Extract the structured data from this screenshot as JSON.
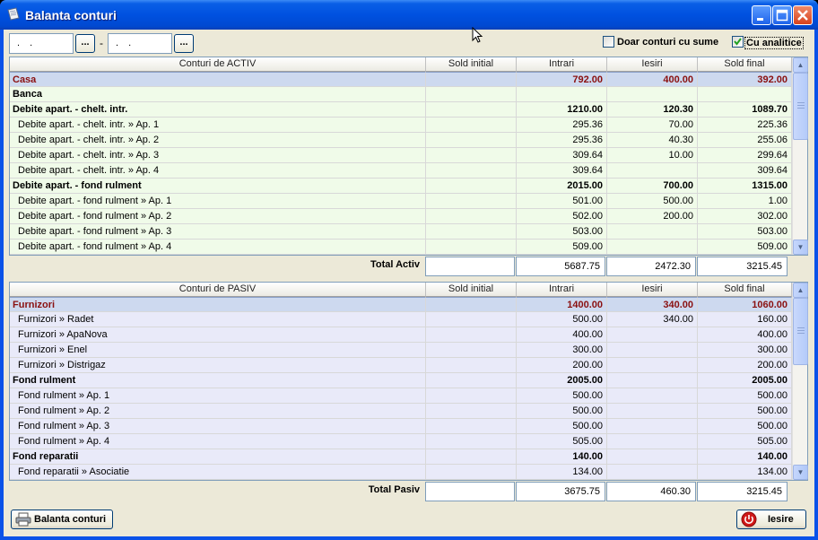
{
  "window": {
    "title": "Balanta conturi"
  },
  "filter": {
    "date_from": " .  . ",
    "date_to": " .  . ",
    "pick_label": "...",
    "separator": "-",
    "only_sums_label": "Doar conturi cu sume",
    "only_sums_checked": false,
    "analytic_label": "Cu analitice",
    "analytic_checked": true
  },
  "columns": [
    "Sold initial",
    "Intrari",
    "Iesiri",
    "Sold final"
  ],
  "activ": {
    "header": "Conturi de ACTIV",
    "rows": [
      {
        "name": "Casa",
        "sold_initial": "",
        "intrari": "792.00",
        "iesiri": "400.00",
        "sold_final": "392.00",
        "type": "selected"
      },
      {
        "name": "Banca",
        "sold_initial": "",
        "intrari": "",
        "iesiri": "",
        "sold_final": "",
        "type": "group"
      },
      {
        "name": "Debite apart. - chelt. intr.",
        "sold_initial": "",
        "intrari": "1210.00",
        "iesiri": "120.30",
        "sold_final": "1089.70",
        "type": "group"
      },
      {
        "name": "Debite apart. - chelt. intr. » Ap. 1",
        "sold_initial": "",
        "intrari": "295.36",
        "iesiri": "70.00",
        "sold_final": "225.36",
        "type": "sub"
      },
      {
        "name": "Debite apart. - chelt. intr. » Ap. 2",
        "sold_initial": "",
        "intrari": "295.36",
        "iesiri": "40.30",
        "sold_final": "255.06",
        "type": "sub"
      },
      {
        "name": "Debite apart. - chelt. intr. » Ap. 3",
        "sold_initial": "",
        "intrari": "309.64",
        "iesiri": "10.00",
        "sold_final": "299.64",
        "type": "sub"
      },
      {
        "name": "Debite apart. - chelt. intr. » Ap. 4",
        "sold_initial": "",
        "intrari": "309.64",
        "iesiri": "",
        "sold_final": "309.64",
        "type": "sub"
      },
      {
        "name": "Debite apart. - fond rulment",
        "sold_initial": "",
        "intrari": "2015.00",
        "iesiri": "700.00",
        "sold_final": "1315.00",
        "type": "group"
      },
      {
        "name": "Debite apart. - fond rulment » Ap. 1",
        "sold_initial": "",
        "intrari": "501.00",
        "iesiri": "500.00",
        "sold_final": "1.00",
        "type": "sub"
      },
      {
        "name": "Debite apart. - fond rulment » Ap. 2",
        "sold_initial": "",
        "intrari": "502.00",
        "iesiri": "200.00",
        "sold_final": "302.00",
        "type": "sub"
      },
      {
        "name": "Debite apart. - fond rulment » Ap. 3",
        "sold_initial": "",
        "intrari": "503.00",
        "iesiri": "",
        "sold_final": "503.00",
        "type": "sub"
      },
      {
        "name": "Debite apart. - fond rulment » Ap. 4",
        "sold_initial": "",
        "intrari": "509.00",
        "iesiri": "",
        "sold_final": "509.00",
        "type": "sub"
      }
    ],
    "total": {
      "label": "Total Activ",
      "sold_initial": "",
      "intrari": "5687.75",
      "iesiri": "2472.30",
      "sold_final": "3215.45"
    }
  },
  "pasiv": {
    "header": "Conturi de PASIV",
    "rows": [
      {
        "name": "Furnizori",
        "sold_initial": "",
        "intrari": "1400.00",
        "iesiri": "340.00",
        "sold_final": "1060.00",
        "type": "selected"
      },
      {
        "name": "Furnizori » Radet",
        "sold_initial": "",
        "intrari": "500.00",
        "iesiri": "340.00",
        "sold_final": "160.00",
        "type": "sub"
      },
      {
        "name": "Furnizori » ApaNova",
        "sold_initial": "",
        "intrari": "400.00",
        "iesiri": "",
        "sold_final": "400.00",
        "type": "sub"
      },
      {
        "name": "Furnizori » Enel",
        "sold_initial": "",
        "intrari": "300.00",
        "iesiri": "",
        "sold_final": "300.00",
        "type": "sub"
      },
      {
        "name": "Furnizori » Distrigaz",
        "sold_initial": "",
        "intrari": "200.00",
        "iesiri": "",
        "sold_final": "200.00",
        "type": "sub"
      },
      {
        "name": "Fond rulment",
        "sold_initial": "",
        "intrari": "2005.00",
        "iesiri": "",
        "sold_final": "2005.00",
        "type": "group"
      },
      {
        "name": "Fond rulment » Ap. 1",
        "sold_initial": "",
        "intrari": "500.00",
        "iesiri": "",
        "sold_final": "500.00",
        "type": "sub"
      },
      {
        "name": "Fond rulment » Ap. 2",
        "sold_initial": "",
        "intrari": "500.00",
        "iesiri": "",
        "sold_final": "500.00",
        "type": "sub"
      },
      {
        "name": "Fond rulment » Ap. 3",
        "sold_initial": "",
        "intrari": "500.00",
        "iesiri": "",
        "sold_final": "500.00",
        "type": "sub"
      },
      {
        "name": "Fond rulment » Ap. 4",
        "sold_initial": "",
        "intrari": "505.00",
        "iesiri": "",
        "sold_final": "505.00",
        "type": "sub"
      },
      {
        "name": "Fond reparatii",
        "sold_initial": "",
        "intrari": "140.00",
        "iesiri": "",
        "sold_final": "140.00",
        "type": "group"
      },
      {
        "name": "Fond reparatii » Asociatie",
        "sold_initial": "",
        "intrari": "134.00",
        "iesiri": "",
        "sold_final": "134.00",
        "type": "sub"
      }
    ],
    "total": {
      "label": "Total Pasiv",
      "sold_initial": "",
      "intrari": "3675.75",
      "iesiri": "460.30",
      "sold_final": "3215.45"
    }
  },
  "footer": {
    "print_label": "Balanta conturi",
    "exit_label": "Iesire"
  },
  "colors": {
    "title_bar": "#0054e3",
    "activ_row": "#f0fbe9",
    "pasiv_row": "#e9eaf9",
    "selected_text": "#8a1010"
  }
}
